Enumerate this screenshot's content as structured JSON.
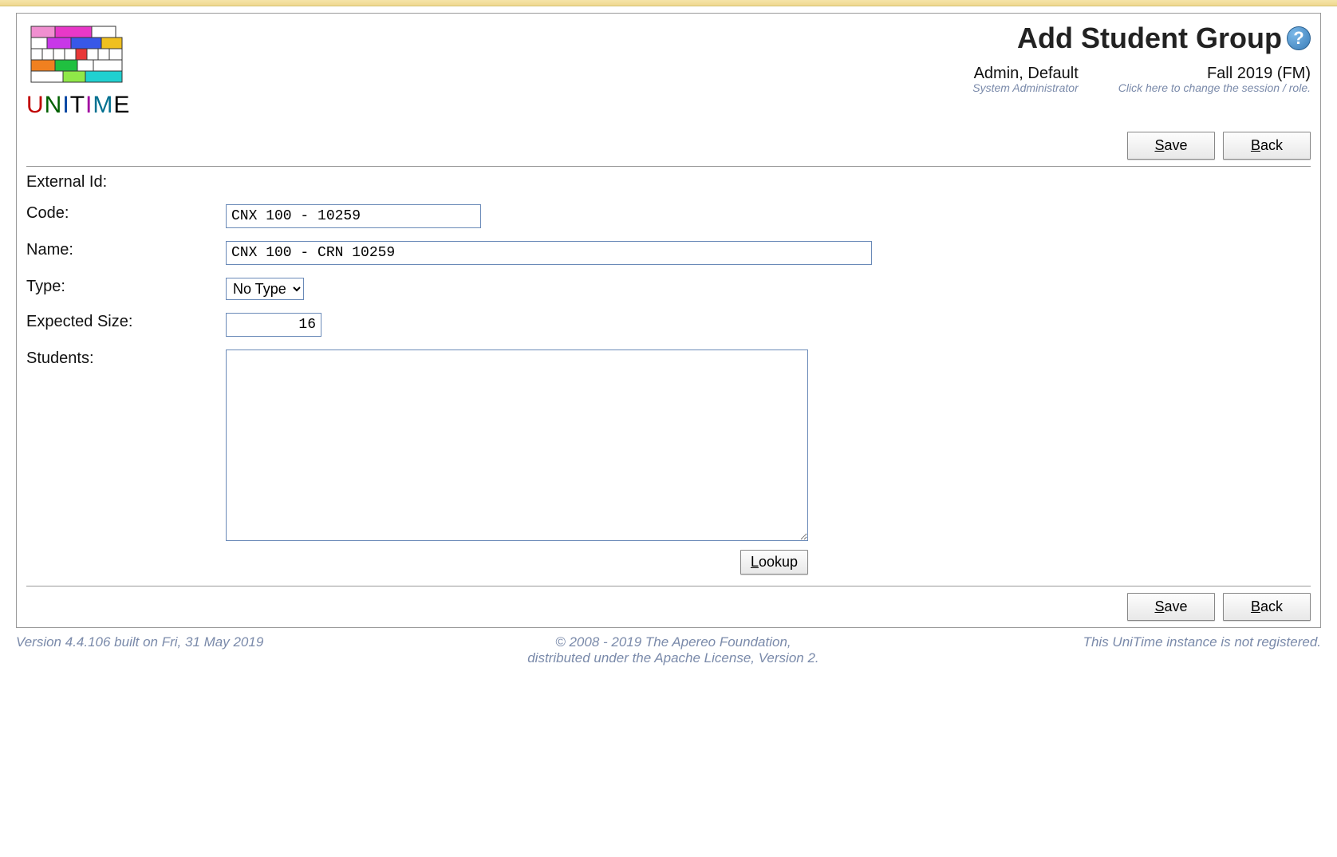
{
  "header": {
    "page_title": "Add Student Group",
    "user_name": "Admin, Default",
    "user_role": "System Administrator",
    "session_name": "Fall 2019 (FM)",
    "session_hint": "Click here to change the session / role."
  },
  "buttons": {
    "save": "Save",
    "back": "Back",
    "lookup": "Lookup"
  },
  "form": {
    "labels": {
      "external_id": "External Id:",
      "code": "Code:",
      "name": "Name:",
      "type": "Type:",
      "expected_size": "Expected Size:",
      "students": "Students:"
    },
    "values": {
      "external_id": "",
      "code": "CNX 100 - 10259",
      "name": "CNX 100 - CRN 10259",
      "type_selected": "No Type",
      "expected_size": "16",
      "students": ""
    },
    "type_options": [
      "No Type"
    ]
  },
  "footer": {
    "version": "Version 4.4.106 built on Fri, 31 May 2019",
    "copyright_line1": "© 2008 - 2019 The Apereo Foundation,",
    "copyright_line2": "distributed under the Apache License, Version 2.",
    "registration": "This UniTime instance is not registered."
  },
  "logo": {
    "text": "UniTime"
  }
}
